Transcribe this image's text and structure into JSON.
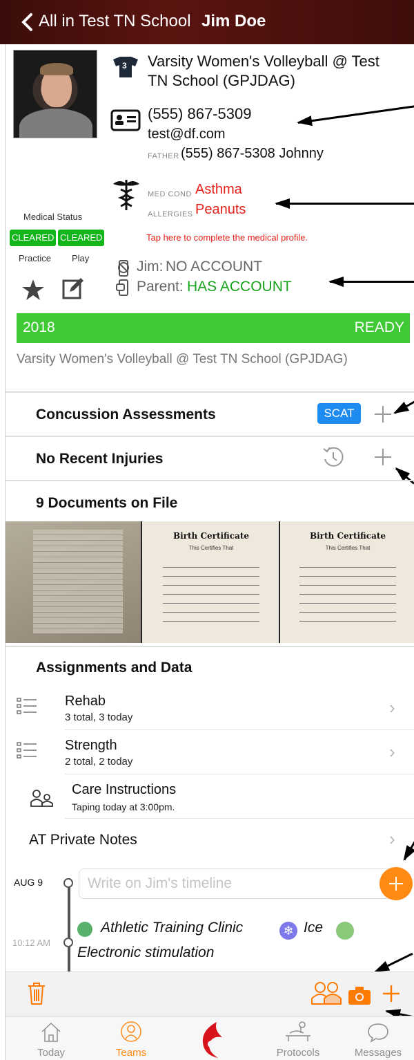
{
  "header": {
    "back_label": "All in Test TN School",
    "athlete_name": "Jim Doe"
  },
  "profile": {
    "team": "Varsity Women's Volleyball @ Test",
    "team_line2": "TN School (GPJDAG)",
    "jersey_number": "3",
    "phone": "(555) 867-5309",
    "email": "test@df.com",
    "father_label": "FATHER",
    "father_contact": "(555) 867-5308 Johnny",
    "med_cond_label": "MED COND",
    "med_cond": "Asthma",
    "allergies_label": "ALLERGIES",
    "allergies": "Peanuts",
    "medical_profile_prompt": "Tap here to complete the medical profile.",
    "account_athlete_label": "Jim:",
    "account_athlete_status": "NO ACCOUNT",
    "account_parent_label": "Parent:",
    "account_parent_status": "HAS ACCOUNT"
  },
  "medical_status": {
    "title": "Medical Status",
    "practice_badge": "CLEARED",
    "play_badge": "CLEARED",
    "practice_label": "Practice",
    "play_label": "Play"
  },
  "season": {
    "year": "2018",
    "status": "READY",
    "team": "Varsity Women's Volleyball @ Test TN School (GPJDAG)"
  },
  "sections": {
    "concussion": "Concussion Assessments",
    "scat_button": "SCAT",
    "injuries": "No Recent Injuries",
    "documents": "9 Documents on File",
    "assignments": "Assignments and Data"
  },
  "documents": {
    "cert_title": "Birth Certificate",
    "cert_subtitle": "This Certifies That"
  },
  "assignments": [
    {
      "title": "Rehab",
      "subtitle": "3 total, 3 today",
      "icon": "list-icon"
    },
    {
      "title": "Strength",
      "subtitle": "2 total, 2 today",
      "icon": "list-icon"
    },
    {
      "title": "Care Instructions",
      "subtitle": "Taping today at 3:00pm.",
      "icon": "people-icon"
    }
  ],
  "private_notes": "AT Private Notes",
  "timeline": {
    "date": "AUG 9",
    "placeholder": "Write on Jim's timeline",
    "entry_time": "10:12 AM",
    "entry_clinic": "Athletic Training Clinic",
    "entry_ice": "Ice",
    "entry_line2": "Electronic stimulation"
  },
  "tabs": [
    {
      "label": "Today"
    },
    {
      "label": "Teams"
    },
    {
      "label": "Protocols"
    },
    {
      "label": "Messages"
    }
  ],
  "colors": {
    "accent": "#ff7a00",
    "cleared": "#12b51a",
    "ready": "#3ec935",
    "scat": "#1e8bf0",
    "alert": "#e8201a"
  }
}
